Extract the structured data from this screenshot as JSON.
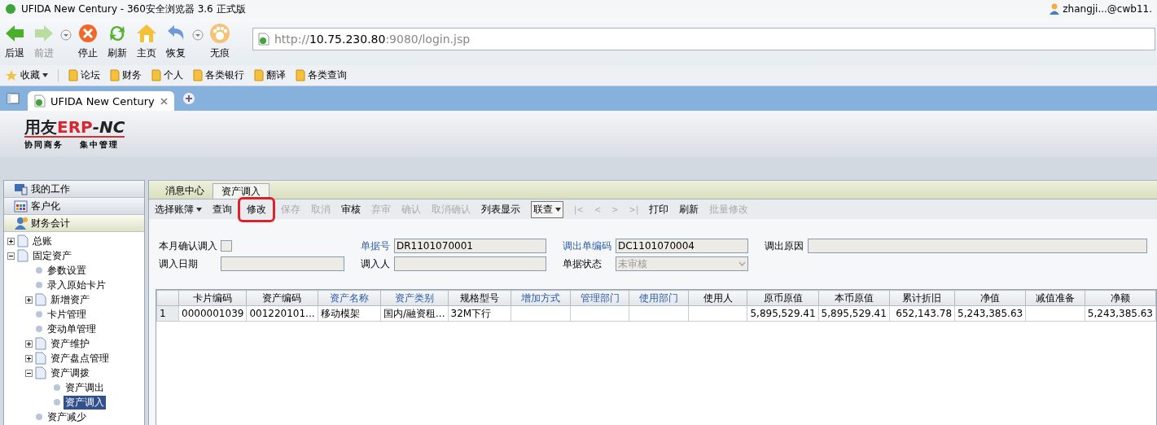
{
  "browser": {
    "title": "UFIDA New Century - 360安全浏览器 3.6 正式版",
    "user": "zhangji...@cwb11.",
    "nav_buttons": [
      {
        "label": "后退",
        "kind": "back",
        "disabled": false,
        "menu": false
      },
      {
        "label": "前进",
        "kind": "forward",
        "disabled": true,
        "menu": true
      },
      {
        "label": "停止",
        "kind": "stop",
        "disabled": false,
        "menu": false
      },
      {
        "label": "刷新",
        "kind": "refresh",
        "disabled": false,
        "menu": false
      },
      {
        "label": "主页",
        "kind": "home",
        "disabled": false,
        "menu": false
      },
      {
        "label": "恢复",
        "kind": "undo",
        "disabled": false,
        "menu": true
      },
      {
        "label": "无痕",
        "kind": "paw",
        "disabled": false,
        "menu": false
      }
    ],
    "address": {
      "scheme": "http://",
      "host": "10.75.230.80",
      "rest": ":9080/login.jsp"
    },
    "bookmarks": [
      {
        "label": "收藏",
        "kind": "favorites"
      },
      {
        "label": "论坛",
        "kind": "folder"
      },
      {
        "label": "财务",
        "kind": "folder"
      },
      {
        "label": "个人",
        "kind": "folder"
      },
      {
        "label": "各类银行",
        "kind": "folder"
      },
      {
        "label": "翻译",
        "kind": "folder"
      },
      {
        "label": "各类查询",
        "kind": "folder"
      }
    ],
    "tabs": [
      {
        "title": "UFIDA New Century",
        "selected": true
      }
    ]
  },
  "app": {
    "logo": {
      "brand": "用友",
      "product": "ERP",
      "suffix": "-NC",
      "tagline_left": "协同商务",
      "tagline_right": "集中管理"
    },
    "sidebar": {
      "sections": [
        {
          "label": "我的工作",
          "kind": "monitor",
          "selected": false
        },
        {
          "label": "客户化",
          "kind": "grid",
          "selected": false
        },
        {
          "label": "财务会计",
          "kind": "user",
          "selected": true
        }
      ],
      "tree": [
        {
          "label": "总账",
          "kind": "folder",
          "expanded": false,
          "selected": false
        },
        {
          "label": "固定资产",
          "kind": "folder",
          "expanded": true,
          "selected": false,
          "children": [
            {
              "label": "参数设置",
              "kind": "leaf",
              "selected": false
            },
            {
              "label": "录入原始卡片",
              "kind": "leaf",
              "selected": false
            },
            {
              "label": "新增资产",
              "kind": "folder",
              "expanded": false,
              "selected": false
            },
            {
              "label": "卡片管理",
              "kind": "leaf",
              "selected": false
            },
            {
              "label": "变动单管理",
              "kind": "leaf",
              "selected": false
            },
            {
              "label": "资产维护",
              "kind": "folder",
              "expanded": false,
              "selected": false
            },
            {
              "label": "资产盘点管理",
              "kind": "folder",
              "expanded": false,
              "selected": false
            },
            {
              "label": "资产调拨",
              "kind": "folder",
              "expanded": true,
              "selected": false,
              "children": [
                {
                  "label": "资产调出",
                  "kind": "leaf",
                  "selected": false
                },
                {
                  "label": "资产调入",
                  "kind": "leaf",
                  "selected": true
                }
              ]
            },
            {
              "label": "资产减少",
              "kind": "leaf",
              "selected": false
            }
          ]
        }
      ]
    },
    "tabs": [
      {
        "label": "消息中心",
        "selected": false
      },
      {
        "label": "资产调入",
        "selected": true
      }
    ],
    "toolbar": [
      {
        "label": "选择账簿",
        "kind": "menu",
        "disabled": false,
        "highlighted": false
      },
      {
        "label": "查询",
        "kind": "button",
        "disabled": false,
        "highlighted": false
      },
      {
        "label": "修改",
        "kind": "button",
        "disabled": false,
        "highlighted": true
      },
      {
        "label": "保存",
        "kind": "button",
        "disabled": true,
        "highlighted": false
      },
      {
        "label": "取消",
        "kind": "button",
        "disabled": true,
        "highlighted": false
      },
      {
        "label": "审核",
        "kind": "button",
        "disabled": false,
        "highlighted": false
      },
      {
        "label": "弃审",
        "kind": "button",
        "disabled": true,
        "highlighted": false
      },
      {
        "label": "确认",
        "kind": "button",
        "disabled": true,
        "highlighted": false
      },
      {
        "label": "取消确认",
        "kind": "button",
        "disabled": true,
        "highlighted": false
      },
      {
        "label": "列表显示",
        "kind": "button",
        "disabled": false,
        "highlighted": false
      },
      {
        "label": "联查",
        "kind": "combo",
        "disabled": false,
        "highlighted": false
      },
      {
        "label": "|<",
        "kind": "nav",
        "disabled": true,
        "highlighted": false
      },
      {
        "label": "<",
        "kind": "nav",
        "disabled": true,
        "highlighted": false
      },
      {
        "label": ">",
        "kind": "nav",
        "disabled": true,
        "highlighted": false
      },
      {
        "label": ">|",
        "kind": "nav",
        "disabled": true,
        "highlighted": false
      },
      {
        "label": "打印",
        "kind": "button",
        "disabled": false,
        "highlighted": false
      },
      {
        "label": "刷新",
        "kind": "button",
        "disabled": false,
        "highlighted": false
      },
      {
        "label": "批量修改",
        "kind": "button",
        "disabled": true,
        "highlighted": false
      }
    ],
    "form": {
      "rows": [
        [
          {
            "label": "本月确认调入",
            "kind": "checkbox",
            "checked": false,
            "emphasis": false
          },
          {
            "label": "单据号",
            "kind": "text",
            "value": "DR1101070001",
            "emphasis": true
          },
          {
            "label": "调出单编码",
            "kind": "text",
            "value": "DC1101070004",
            "emphasis": true
          },
          {
            "label": "调出原因",
            "kind": "text",
            "emphasis": false
          }
        ],
        [
          {
            "label": "调入日期",
            "kind": "text",
            "emphasis": false
          },
          {
            "label": "调入人",
            "kind": "text",
            "emphasis": false
          },
          {
            "label": "单据状态",
            "kind": "select",
            "value": "未审核",
            "disabled": true,
            "emphasis": false
          }
        ]
      ]
    },
    "table": {
      "columns": [
        {
          "label": "卡片编码",
          "linked": false,
          "kind": "text"
        },
        {
          "label": "资产编码",
          "linked": false,
          "kind": "text"
        },
        {
          "label": "资产名称",
          "linked": true,
          "kind": "text"
        },
        {
          "label": "资产类别",
          "linked": true,
          "kind": "text"
        },
        {
          "label": "规格型号",
          "linked": false,
          "kind": "text"
        },
        {
          "label": "增加方式",
          "linked": true,
          "kind": "text"
        },
        {
          "label": "管理部门",
          "linked": true,
          "kind": "text"
        },
        {
          "label": "使用部门",
          "linked": true,
          "kind": "text"
        },
        {
          "label": "使用人",
          "linked": false,
          "kind": "text"
        },
        {
          "label": "原币原值",
          "linked": false,
          "kind": "number"
        },
        {
          "label": "本币原值",
          "linked": false,
          "kind": "number"
        },
        {
          "label": "累计折旧",
          "linked": false,
          "kind": "number"
        },
        {
          "label": "净值",
          "linked": false,
          "kind": "number"
        },
        {
          "label": "减值准备",
          "linked": false,
          "kind": "number"
        },
        {
          "label": "净额",
          "linked": false,
          "kind": "number"
        }
      ],
      "rows": [
        {
          "index": "1",
          "cells": [
            "0000001039",
            "001220101...",
            "移动模架",
            "国内/融资租...",
            "32M下行",
            null,
            null,
            null,
            null,
            "5,895,529.41",
            "5,895,529.41",
            "652,143.78",
            "5,243,385.63",
            null,
            "5,243,385.63"
          ]
        }
      ]
    }
  }
}
